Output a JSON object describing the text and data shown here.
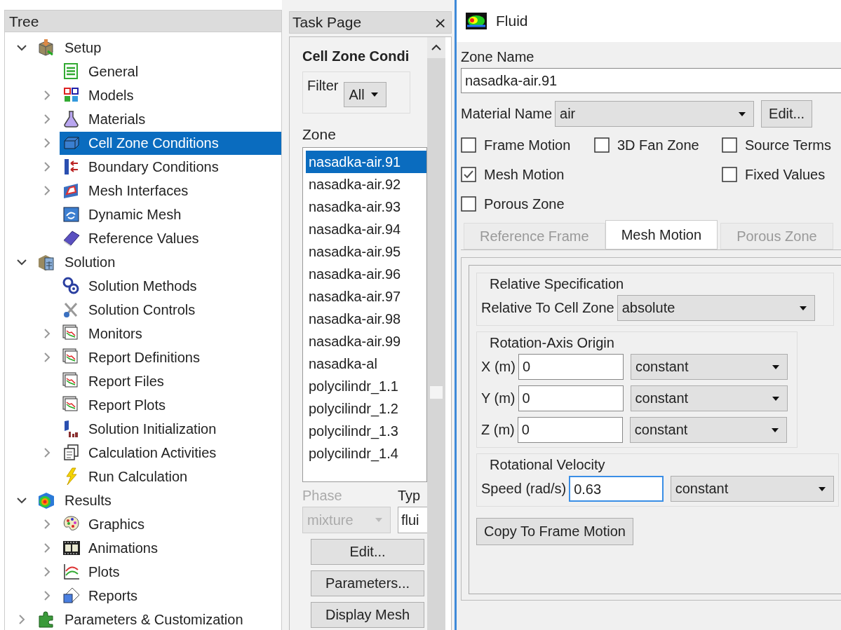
{
  "tree": {
    "title": "Tree",
    "items": [
      {
        "label": "Setup",
        "expanded": true,
        "selected": false,
        "children": [
          {
            "label": "General",
            "selected": false
          },
          {
            "label": "Models",
            "expanded": false,
            "selected": false
          },
          {
            "label": "Materials",
            "expanded": false,
            "selected": false
          },
          {
            "label": "Cell Zone Conditions",
            "expanded": false,
            "selected": true
          },
          {
            "label": "Boundary Conditions",
            "expanded": false,
            "selected": false
          },
          {
            "label": "Mesh Interfaces",
            "expanded": false,
            "selected": false
          },
          {
            "label": "Dynamic Mesh",
            "selected": false
          },
          {
            "label": "Reference Values",
            "selected": false
          }
        ]
      },
      {
        "label": "Solution",
        "expanded": true,
        "selected": false,
        "children": [
          {
            "label": "Solution Methods",
            "selected": false
          },
          {
            "label": "Solution Controls",
            "selected": false
          },
          {
            "label": "Monitors",
            "expanded": false,
            "selected": false
          },
          {
            "label": "Report Definitions",
            "expanded": false,
            "selected": false
          },
          {
            "label": "Report Files",
            "selected": false
          },
          {
            "label": "Report Plots",
            "selected": false
          },
          {
            "label": "Solution Initialization",
            "selected": false
          },
          {
            "label": "Calculation Activities",
            "expanded": false,
            "selected": false
          },
          {
            "label": "Run Calculation",
            "selected": false
          }
        ]
      },
      {
        "label": "Results",
        "expanded": true,
        "selected": false,
        "children": [
          {
            "label": "Graphics",
            "expanded": false,
            "selected": false
          },
          {
            "label": "Animations",
            "expanded": false,
            "selected": false
          },
          {
            "label": "Plots",
            "expanded": false,
            "selected": false
          },
          {
            "label": "Reports",
            "expanded": false,
            "selected": false
          }
        ]
      },
      {
        "label": "Parameters & Customization",
        "expanded": false,
        "selected": false
      }
    ]
  },
  "task": {
    "title": "Task Page",
    "close": "×",
    "heading": "Cell Zone Condi",
    "filter": {
      "label": "Filter",
      "value": "All"
    },
    "zone_label": "Zone",
    "zones": [
      {
        "name": "nasadka-air.91",
        "selected": true
      },
      {
        "name": "nasadka-air.92",
        "selected": false
      },
      {
        "name": "nasadka-air.93",
        "selected": false
      },
      {
        "name": "nasadka-air.94",
        "selected": false
      },
      {
        "name": "nasadka-air.95",
        "selected": false
      },
      {
        "name": "nasadka-air.96",
        "selected": false
      },
      {
        "name": "nasadka-air.97",
        "selected": false
      },
      {
        "name": "nasadka-air.98",
        "selected": false
      },
      {
        "name": "nasadka-air.99",
        "selected": false
      },
      {
        "name": "nasadka-al",
        "selected": false
      },
      {
        "name": "polycilindr_1.1",
        "selected": false
      },
      {
        "name": "polycilindr_1.2",
        "selected": false
      },
      {
        "name": "polycilindr_1.3",
        "selected": false
      },
      {
        "name": "polycilindr_1.4",
        "selected": false
      }
    ],
    "phase": {
      "label": "Phase",
      "value": "mixture",
      "disabled": true
    },
    "type": {
      "label": "Typ",
      "value": "flui",
      "disabled": false
    },
    "buttons": [
      "Edit...",
      "Parameters...",
      "Display Mesh"
    ]
  },
  "fluid": {
    "title": "Fluid",
    "zone_name_label": "Zone Name",
    "zone_name": "nasadka-air.91",
    "material_label": "Material Name",
    "material": "air",
    "material_button": "Edit...",
    "checkbox_columns": [
      [
        {
          "label": "Frame Motion",
          "checked": false
        },
        {
          "label": "Mesh Motion",
          "checked": true
        },
        {
          "label": "Porous Zone",
          "checked": false
        }
      ],
      [
        {
          "label": "3D Fan Zone",
          "checked": false
        }
      ],
      [
        {
          "label": "Source Terms",
          "checked": false
        },
        {
          "label": "Fixed Values",
          "checked": false
        }
      ]
    ],
    "tabs": [
      {
        "label": "Reference Frame",
        "selected": false
      },
      {
        "label": "Mesh Motion",
        "selected": true
      },
      {
        "label": "Porous Zone",
        "selected": false
      }
    ],
    "relative": {
      "title": "Relative Specification",
      "label": "Relative To Cell Zone",
      "value": "absolute"
    },
    "origin": {
      "title": "Rotation-Axis Origin",
      "rows": [
        {
          "label": "X (m)",
          "value": "0",
          "profile": "constant",
          "focused": false
        },
        {
          "label": "Y (m)",
          "value": "0",
          "profile": "constant",
          "focused": false
        },
        {
          "label": "Z (m)",
          "value": "0",
          "profile": "constant",
          "focused": false
        }
      ]
    },
    "velocity": {
      "title": "Rotational Velocity",
      "label": "Speed (rad/s)",
      "value": "0.63",
      "profile": "constant",
      "focused": true
    },
    "copy_button": "Copy To Frame Motion"
  }
}
